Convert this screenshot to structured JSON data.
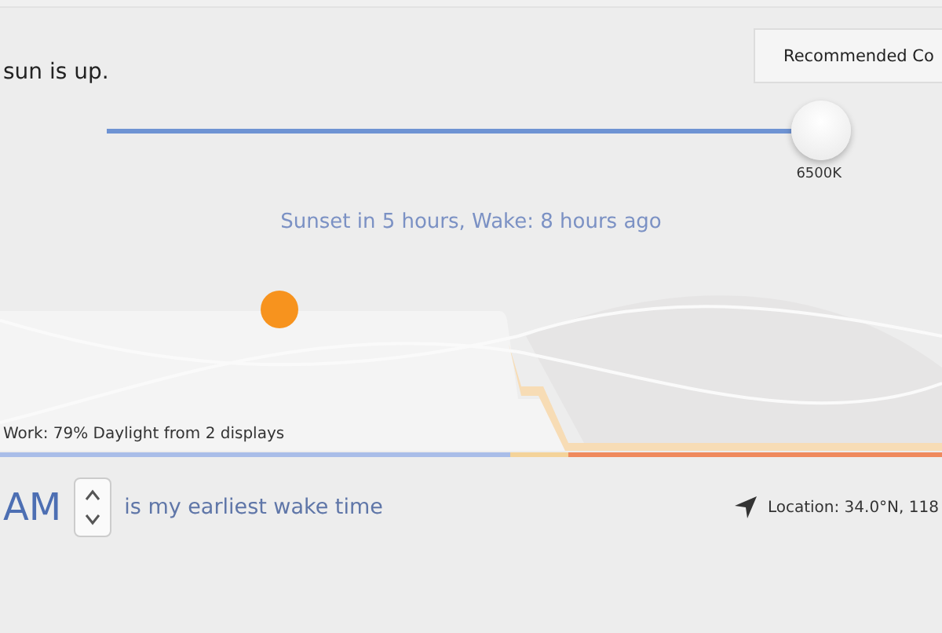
{
  "header": {
    "message": "sun is up.",
    "button": "Recommended Co"
  },
  "slider": {
    "reading": "6500K"
  },
  "status": "Sunset in 5 hours, Wake: 8 hours ago",
  "timeline": {
    "caption": "Work: 79% Daylight from 2 displays"
  },
  "wake": {
    "value": "AM",
    "label": "is my earliest wake time"
  },
  "location": "Location: 34.0°N, 118"
}
